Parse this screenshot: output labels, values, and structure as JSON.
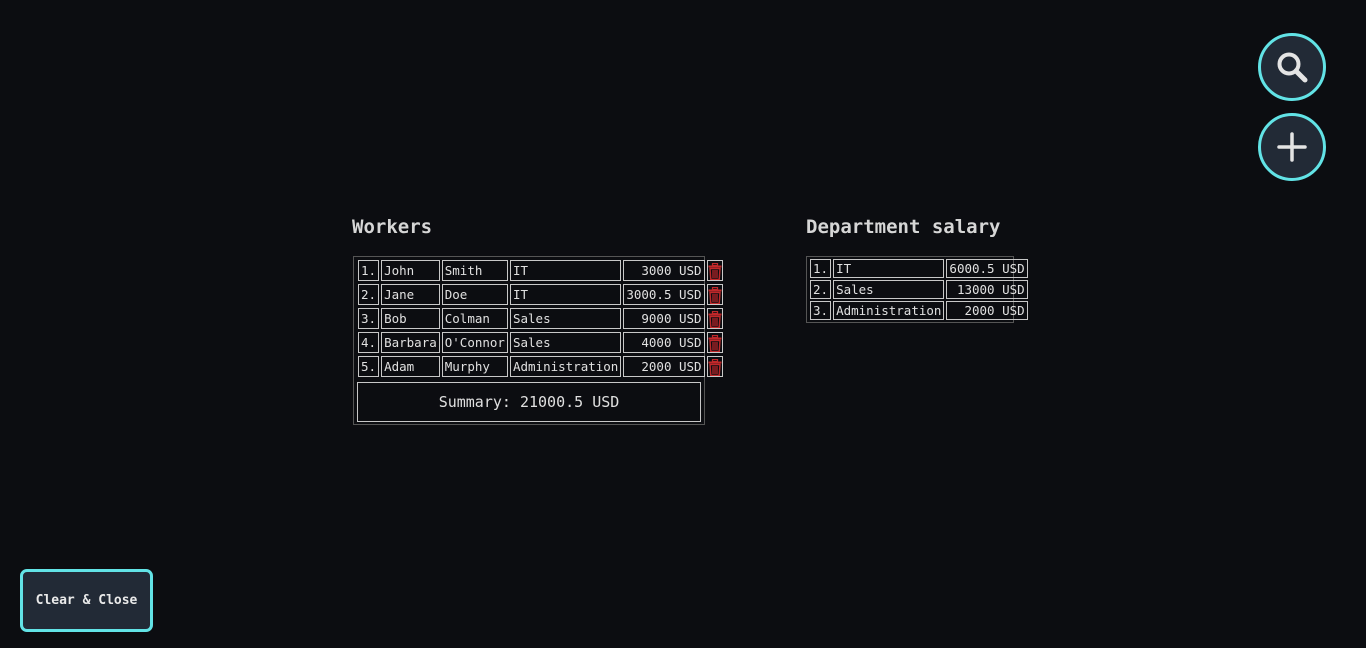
{
  "actions": {
    "search_icon": "search-icon",
    "add_icon": "plus-icon",
    "clear_close_label": "Clear & Close"
  },
  "workers": {
    "title": "Workers",
    "rows": [
      {
        "num": "1.",
        "first": "John",
        "last": "Smith",
        "dept": "IT",
        "salary": "3000 USD"
      },
      {
        "num": "2.",
        "first": "Jane",
        "last": "Doe",
        "dept": "IT",
        "salary": "3000.5 USD"
      },
      {
        "num": "3.",
        "first": "Bob",
        "last": "Colman",
        "dept": "Sales",
        "salary": "9000 USD"
      },
      {
        "num": "4.",
        "first": "Barbara",
        "last": "O'Connor",
        "dept": "Sales",
        "salary": "4000 USD"
      },
      {
        "num": "5.",
        "first": "Adam",
        "last": "Murphy",
        "dept": "Administration",
        "salary": "2000 USD"
      }
    ],
    "summary": "Summary: 21000.5 USD"
  },
  "department_salary": {
    "title": "Department salary",
    "rows": [
      {
        "num": "1.",
        "dept": "IT",
        "salary": "6000.5 USD"
      },
      {
        "num": "2.",
        "dept": "Sales",
        "salary": "13000 USD"
      },
      {
        "num": "3.",
        "dept": "Administration",
        "salary": "2000 USD"
      }
    ]
  },
  "colors": {
    "accent": "#62e3e6",
    "button_bg": "#222a36",
    "delete": "#c0282a",
    "background": "#0c0d11"
  }
}
